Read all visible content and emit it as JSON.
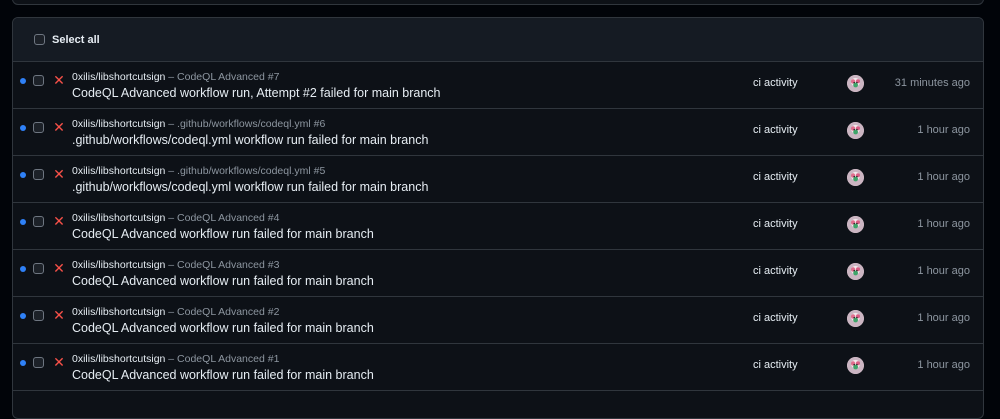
{
  "header": {
    "select_all_label": "Select all"
  },
  "colors": {
    "unread": "#2f81f7",
    "failed": "#f85149",
    "border": "#30363d"
  },
  "icons": {
    "status": "x-icon",
    "unread": "unread-dot-icon",
    "avatar": "avatar"
  },
  "notifications": [
    {
      "repo": "0xilis/libshortcutsign",
      "context": " – CodeQL Advanced #7",
      "title": "CodeQL Advanced workflow run, Attempt #2 failed for main branch",
      "reason": "ci activity",
      "time": "31 minutes ago"
    },
    {
      "repo": "0xilis/libshortcutsign",
      "context": " – .github/workflows/codeql.yml #6",
      "title": ".github/workflows/codeql.yml workflow run failed for main branch",
      "reason": "ci activity",
      "time": "1 hour ago"
    },
    {
      "repo": "0xilis/libshortcutsign",
      "context": " – .github/workflows/codeql.yml #5",
      "title": ".github/workflows/codeql.yml workflow run failed for main branch",
      "reason": "ci activity",
      "time": "1 hour ago"
    },
    {
      "repo": "0xilis/libshortcutsign",
      "context": " – CodeQL Advanced #4",
      "title": "CodeQL Advanced workflow run failed for main branch",
      "reason": "ci activity",
      "time": "1 hour ago"
    },
    {
      "repo": "0xilis/libshortcutsign",
      "context": " – CodeQL Advanced #3",
      "title": "CodeQL Advanced workflow run failed for main branch",
      "reason": "ci activity",
      "time": "1 hour ago"
    },
    {
      "repo": "0xilis/libshortcutsign",
      "context": " – CodeQL Advanced #2",
      "title": "CodeQL Advanced workflow run failed for main branch",
      "reason": "ci activity",
      "time": "1 hour ago"
    },
    {
      "repo": "0xilis/libshortcutsign",
      "context": " – CodeQL Advanced #1",
      "title": "CodeQL Advanced workflow run failed for main branch",
      "reason": "ci activity",
      "time": "1 hour ago"
    }
  ]
}
